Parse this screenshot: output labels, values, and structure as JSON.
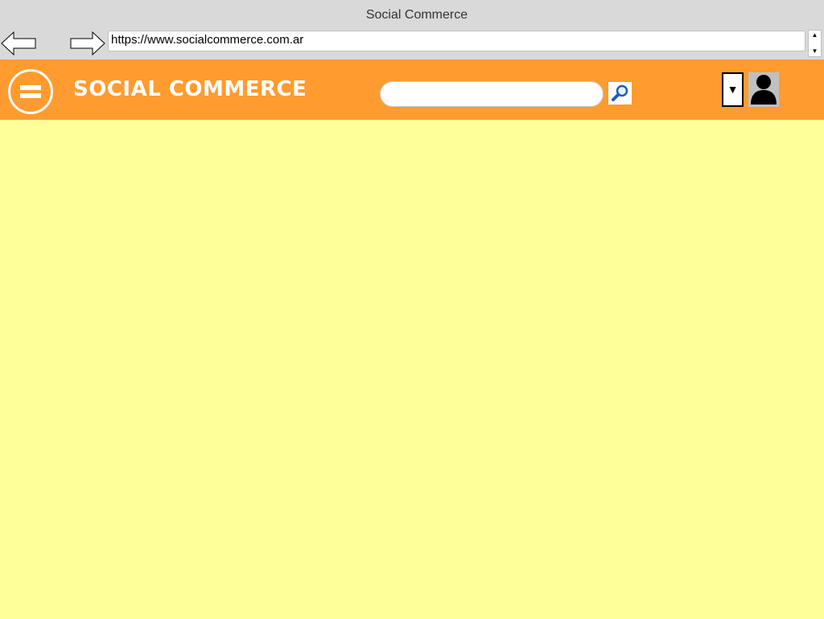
{
  "window": {
    "title": "Social Commerce"
  },
  "browser": {
    "address": "https://www.socialcommerce.com.ar",
    "back_icon": "back-arrow-icon",
    "forward_icon": "forward-arrow-icon"
  },
  "header": {
    "brand": "SOCIAL COMMERCE",
    "menu_icon": "hamburger-menu-icon",
    "search": {
      "value": "",
      "placeholder": "",
      "button_icon": "search-icon"
    },
    "user_menu_icon": "dropdown-triangle-icon",
    "avatar_icon": "user-avatar-icon"
  },
  "colors": {
    "chrome": "#d9d9d9",
    "header": "#ff9b2f",
    "content": "#ffff99",
    "search_icon": "#1f5fb8"
  }
}
